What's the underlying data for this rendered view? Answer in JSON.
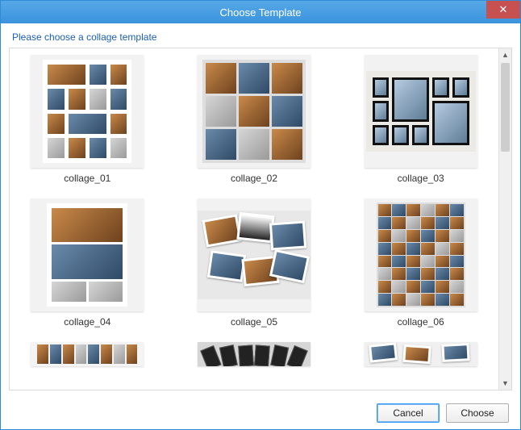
{
  "window": {
    "title": "Choose Template",
    "close_glyph": "✕"
  },
  "instruction": "Please choose a collage template",
  "templates": [
    {
      "id": "collage_01",
      "label": "collage_01"
    },
    {
      "id": "collage_02",
      "label": "collage_02"
    },
    {
      "id": "collage_03",
      "label": "collage_03"
    },
    {
      "id": "collage_04",
      "label": "collage_04"
    },
    {
      "id": "collage_05",
      "label": "collage_05"
    },
    {
      "id": "collage_06",
      "label": "collage_06"
    }
  ],
  "buttons": {
    "cancel": "Cancel",
    "choose": "Choose"
  },
  "scrollbar": {
    "up_glyph": "▲",
    "down_glyph": "▼"
  }
}
